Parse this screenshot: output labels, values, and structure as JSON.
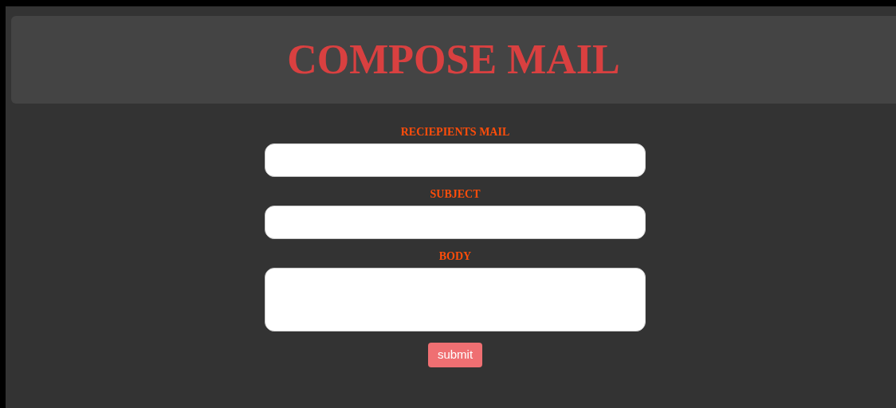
{
  "header": {
    "title": "COMPOSE MAIL"
  },
  "fields": [
    {
      "label": "RECIEPIENTS MAIL",
      "kind": "input"
    },
    {
      "label": "SUBJECT",
      "kind": "input"
    },
    {
      "label": "BODY",
      "kind": "textarea"
    }
  ],
  "submit_button": {
    "label": "submit"
  }
}
